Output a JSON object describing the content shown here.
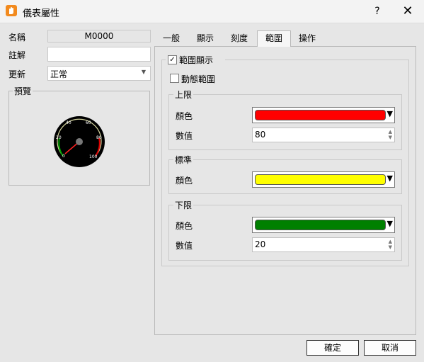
{
  "window": {
    "title": "儀表屬性",
    "help_label": "?",
    "close_label": "✕",
    "app_icon": "hand-icon"
  },
  "left": {
    "name_label": "名稱",
    "name_value": "M0000",
    "comment_label": "註解",
    "comment_value": "",
    "update_label": "更新",
    "update_value": "正常",
    "preview_label": "預覽",
    "gauge_ticks": [
      "0",
      "20",
      "40",
      "60",
      "80",
      "100"
    ]
  },
  "tabs": [
    "一般",
    "顯示",
    "刻度",
    "範圍",
    "操作"
  ],
  "range_tab": {
    "show_range_label": "範圍顯示",
    "show_range_checked": true,
    "dynamic_range_label": "動態範圍",
    "dynamic_range_checked": false,
    "upper": {
      "title": "上限",
      "color_label": "顏色",
      "color": "#ff0000",
      "value_label": "數值",
      "value": "80"
    },
    "standard": {
      "title": "標準",
      "color_label": "顏色",
      "color": "#ffff00"
    },
    "lower": {
      "title": "下限",
      "color_label": "顏色",
      "color": "#008000",
      "value_label": "數值",
      "value": "20"
    }
  },
  "buttons": {
    "ok": "確定",
    "cancel": "取消"
  }
}
